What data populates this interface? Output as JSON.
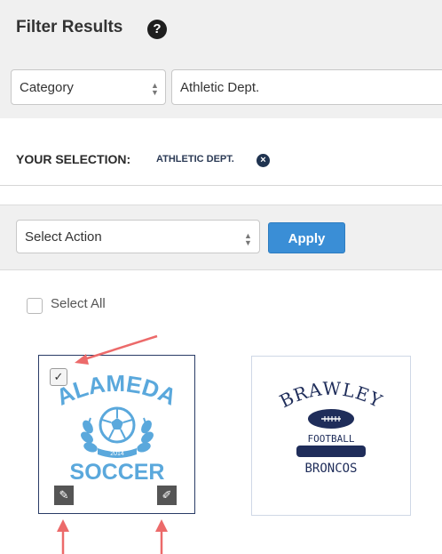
{
  "filter": {
    "title": "Filter Results",
    "help_icon": "question-circle-icon",
    "category_select": "Category",
    "value_select": "Athletic Dept."
  },
  "selection": {
    "label": "YOUR SELECTION:",
    "value": "ATHLETIC DEPT."
  },
  "actions": {
    "select_action": "Select Action",
    "apply_label": "Apply"
  },
  "select_all_label": "Select All",
  "cards": [
    {
      "logo_text_top": "ALAMEDA",
      "logo_year": "2014",
      "logo_text_bottom": "SOCCER",
      "checked": true,
      "colors": {
        "primary": "#5aa8dc",
        "border": "#2a3c66"
      }
    },
    {
      "logo_text_top": "BRAWLEY",
      "logo_text_mid": "FOOTBALL",
      "logo_text_bottom": "BRONCOS",
      "checked": false,
      "colors": {
        "primary": "#1f2d5a"
      }
    }
  ],
  "colors": {
    "accent": "#3a8ed6",
    "annotation": "#ec6a6a",
    "header_bg": "#f0f0f0"
  }
}
